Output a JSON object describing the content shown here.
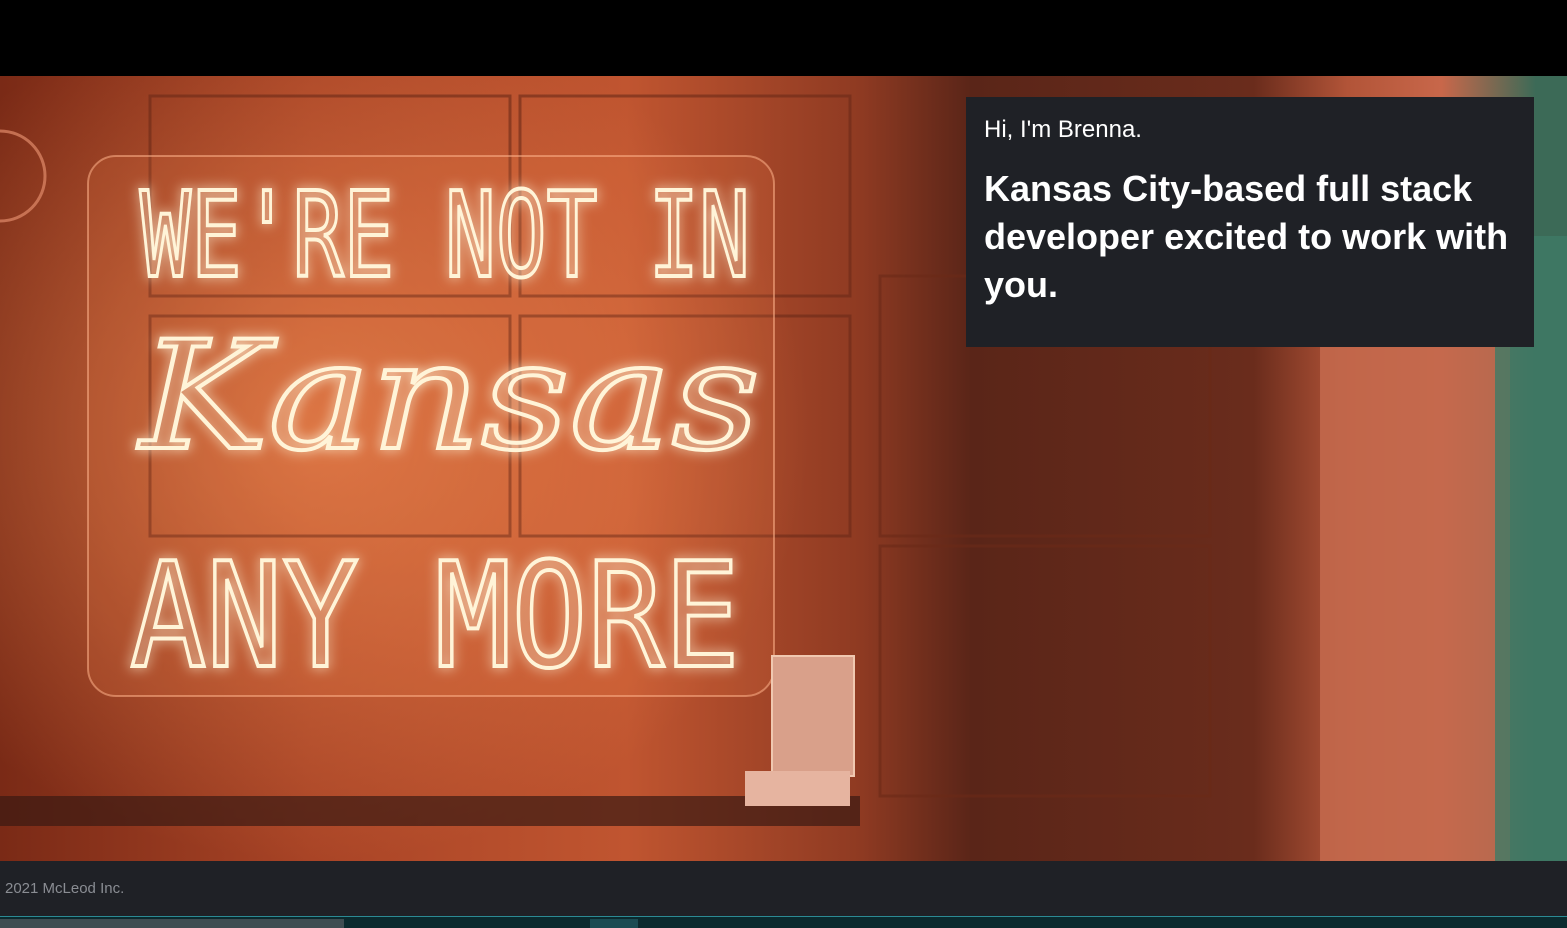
{
  "hero": {
    "sign_lines": [
      "WE'RE NOT IN",
      "Kansas",
      "ANY MORE"
    ]
  },
  "card": {
    "greeting": "Hi, I'm Brenna.",
    "tagline": "Kansas City-based full stack developer excited to work with you."
  },
  "footer": {
    "copyright": "2021 McLeod Inc."
  },
  "colors": {
    "card_bg": "#1f2126",
    "neon": "#fff4d8",
    "neon_glow": "#ff7a3c",
    "footer_text": "#8a8d93"
  }
}
